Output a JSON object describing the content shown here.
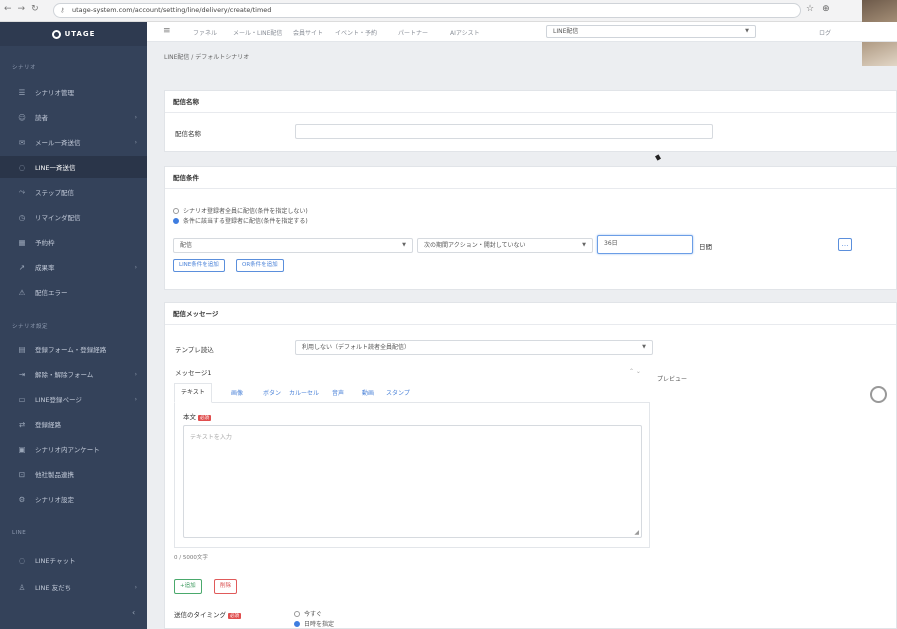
{
  "browser": {
    "url": "utage-system.com/account/setting/line/delivery/create/timed",
    "nav_icons": [
      "back-icon",
      "forward-icon",
      "reload-icon"
    ]
  },
  "sidebar": {
    "logo": "UTAGE",
    "section_top": "シナリオ",
    "items": [
      {
        "label": "シナリオ管理",
        "icon": "list-icon",
        "chevron": false
      },
      {
        "label": "読者",
        "icon": "users-icon",
        "chevron": true
      },
      {
        "label": "メール一斉送信",
        "icon": "mail-icon",
        "chevron": true
      },
      {
        "label": "LINE一斉送信",
        "icon": "chat-icon",
        "chevron": false
      },
      {
        "label": "ステップ配信",
        "icon": "step-icon",
        "chevron": false
      },
      {
        "label": "リマインダ配信",
        "icon": "clock-icon",
        "chevron": false
      },
      {
        "label": "予約枠",
        "icon": "calendar-icon",
        "chevron": false
      },
      {
        "label": "成果率",
        "icon": "chart-icon",
        "chevron": true
      },
      {
        "label": "配信エラー",
        "icon": "warning-icon",
        "chevron": false
      }
    ],
    "section_mid": "シナリオ設定",
    "items_mid": [
      {
        "label": "登録フォーム・登録経路",
        "icon": "form-icon",
        "chevron": false
      },
      {
        "label": "解除・解除フォーム",
        "icon": "door-icon",
        "chevron": true
      },
      {
        "label": "LINE登録ページ",
        "icon": "page-icon",
        "chevron": true
      },
      {
        "label": "登録経路",
        "icon": "route-icon",
        "chevron": false
      },
      {
        "label": "シナリオ内アンケート",
        "icon": "survey-icon",
        "chevron": false
      },
      {
        "label": "他社製品連携",
        "icon": "link-icon",
        "chevron": false
      },
      {
        "label": "シナリオ設定",
        "icon": "gear-icon",
        "chevron": false
      }
    ],
    "section_bottom": "LINE",
    "items_bottom": [
      {
        "label": "LINEチャット",
        "icon": "chat-icon",
        "chevron": false
      },
      {
        "label": "LINE 友だち",
        "icon": "friend-icon",
        "chevron": true
      }
    ]
  },
  "topnav": {
    "items": [
      "ファネル",
      "メール・LINE配信",
      "会員サイト",
      "イベント・予約",
      "パートナー",
      "AIアシスト"
    ],
    "account_select": "LINE配信",
    "right_label": "ログ"
  },
  "breadcrumb": "LINE配信 / デフォルトシナリオ",
  "delivery_name": {
    "section_title": "配信名称",
    "label": "配信名称",
    "value": ""
  },
  "conditions": {
    "section_title": "配信条件",
    "radio_all": "シナリオ登録者全員に配信(条件を指定しない)",
    "radio_filter": "条件に該当する登録者に配信(条件を指定する)",
    "filter_field": "配信",
    "filter_operator": "次の期間アクション・開封していない",
    "filter_value": "36日",
    "filter_unit": "日間",
    "add_line_condition": "LINE条件を追加",
    "add_condition": "OR条件を追加",
    "more_button": "…"
  },
  "message": {
    "section_title": "配信メッセージ",
    "template_label": "テンプレ読込",
    "template_value": "利用しない（デフォルト読者全員配信）",
    "message_label": "メッセージ1",
    "tabs": [
      "テキスト",
      "画像",
      "ボタン",
      "カルーセル",
      "音声",
      "動画",
      "スタンプ"
    ],
    "text_label": "本文",
    "required_badge": "必須",
    "text_placeholder": "テキストを入力",
    "char_counter": "0 / 5000文字",
    "add_button": "+追加",
    "delete_button": "削除",
    "preview_label": "プレビュー",
    "controls": "⌃ ⌄"
  },
  "timing": {
    "label": "送信のタイミング",
    "required_badge": "必須",
    "option_now": "今すぐ",
    "option_scheduled": "日時を指定"
  }
}
